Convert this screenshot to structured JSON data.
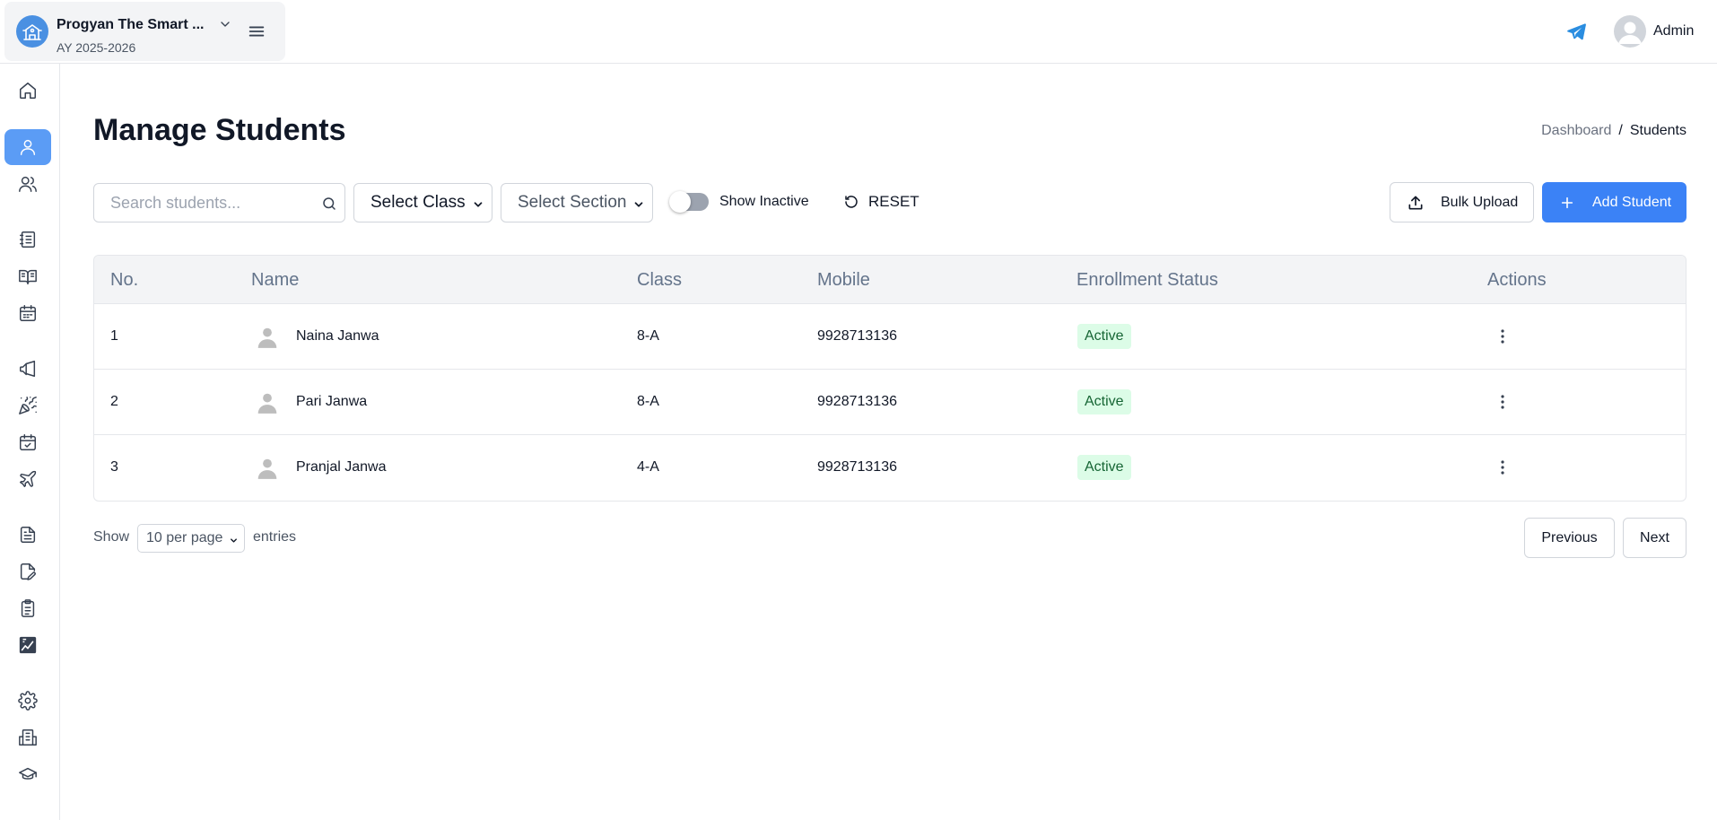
{
  "header": {
    "school_name": "Progyan The Smart ...",
    "academic_year": "AY 2025-2026",
    "user_name": "Admin"
  },
  "sidebar": {
    "items": [
      {
        "icon": "home-icon",
        "active": false
      },
      {
        "icon": "user-icon",
        "active": true
      },
      {
        "icon": "users-icon",
        "active": false
      },
      {
        "icon": "notebook-icon",
        "active": false
      },
      {
        "icon": "book-open-icon",
        "active": false
      },
      {
        "icon": "calendar-icon",
        "active": false
      },
      {
        "icon": "megaphone-icon",
        "active": false
      },
      {
        "icon": "party-popper-icon",
        "active": false
      },
      {
        "icon": "calendar-check-icon",
        "active": false
      },
      {
        "icon": "plane-icon",
        "active": false
      },
      {
        "icon": "file-text-icon",
        "active": false
      },
      {
        "icon": "file-edit-icon",
        "active": false
      },
      {
        "icon": "clipboard-icon",
        "active": false
      },
      {
        "icon": "image-chart-icon",
        "active": false
      },
      {
        "icon": "settings-icon",
        "active": false
      },
      {
        "icon": "building-icon",
        "active": false
      },
      {
        "icon": "graduation-cap-icon",
        "active": false
      }
    ],
    "active_color": "#5b9cf5"
  },
  "page": {
    "title": "Manage Students",
    "breadcrumb": {
      "parent": "Dashboard",
      "separator": "/",
      "current": "Students"
    }
  },
  "filters": {
    "search_placeholder": "Search students...",
    "class_select": "Select Class",
    "section_select": "Select Section",
    "show_inactive_label": "Show Inactive",
    "show_inactive_on": false,
    "reset_label": "RESET"
  },
  "actions": {
    "bulk_upload_label": "Bulk Upload",
    "add_student_label": "Add Student",
    "primary_color": "#3b82f6"
  },
  "table": {
    "headers": {
      "no": "No.",
      "name": "Name",
      "class": "Class",
      "mobile": "Mobile",
      "status": "Enrollment Status",
      "actions": "Actions"
    },
    "rows": [
      {
        "no": "1",
        "name": "Naina Janwa",
        "class": "8-A",
        "mobile": "9928713136",
        "status": "Active"
      },
      {
        "no": "2",
        "name": "Pari Janwa",
        "class": "8-A",
        "mobile": "9928713136",
        "status": "Active"
      },
      {
        "no": "3",
        "name": "Pranjal Janwa",
        "class": "4-A",
        "mobile": "9928713136",
        "status": "Active"
      }
    ],
    "status_colors": {
      "bg": "#dcfce7",
      "text": "#166534"
    }
  },
  "pagination": {
    "show_label": "Show",
    "per_page": "10 per page",
    "entries_label": "entries",
    "previous_label": "Previous",
    "next_label": "Next"
  }
}
